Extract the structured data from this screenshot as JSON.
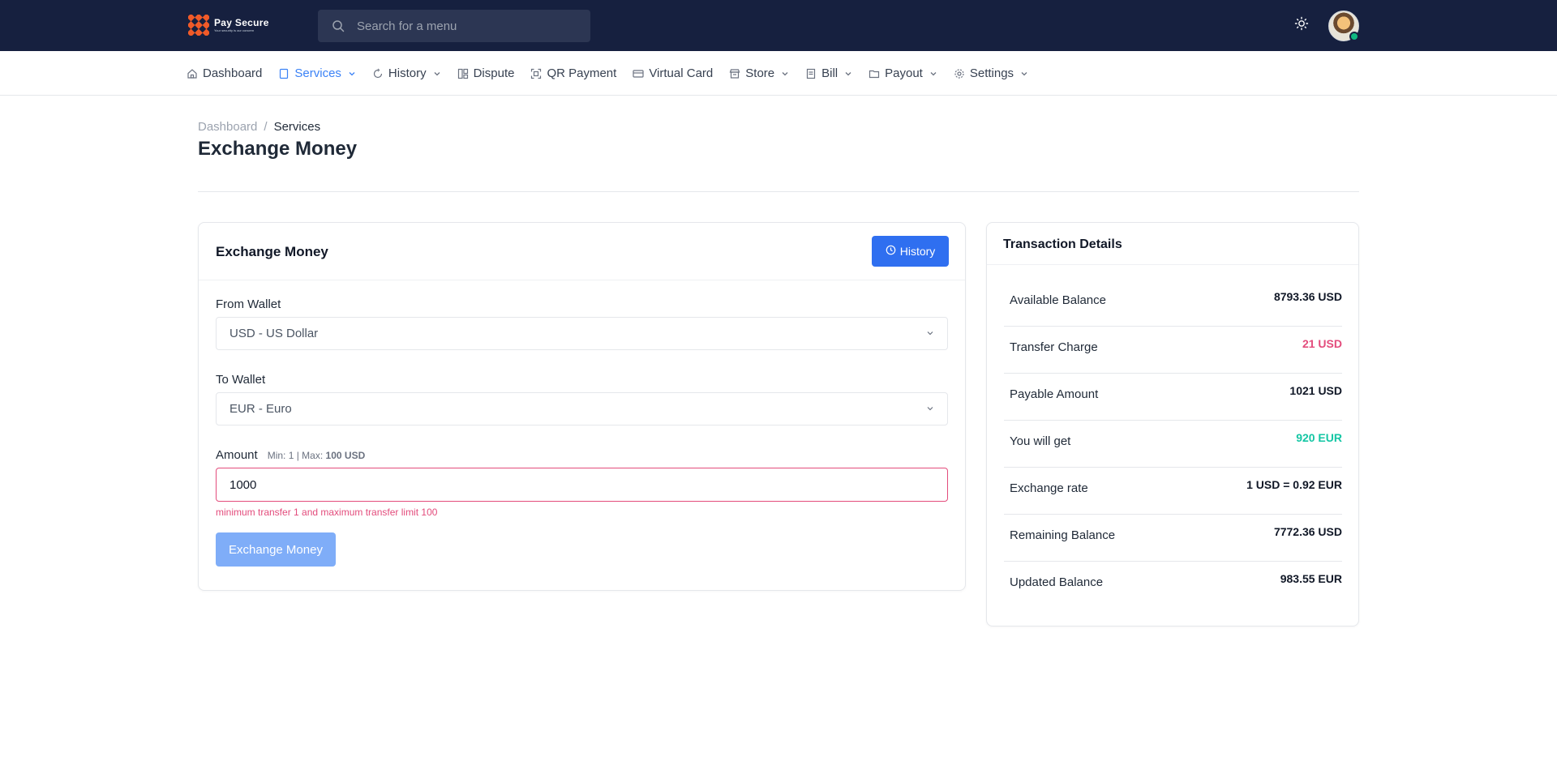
{
  "brand": {
    "name": "Pay Secure",
    "tagline": "Your security is our concern"
  },
  "search": {
    "placeholder": "Search for a menu"
  },
  "icons": {
    "theme": "sun-icon",
    "search": "search-icon"
  },
  "colors": {
    "topbar": "#16203f",
    "primary": "#2f6ff0",
    "error": "#e34c7c",
    "success": "#14c6a4"
  },
  "nav": [
    {
      "label": "Dashboard",
      "icon": "home-icon",
      "dropdown": false,
      "active": false
    },
    {
      "label": "Services",
      "icon": "page-icon",
      "dropdown": true,
      "active": true
    },
    {
      "label": "History",
      "icon": "refresh-icon",
      "dropdown": true,
      "active": false
    },
    {
      "label": "Dispute",
      "icon": "layout-icon",
      "dropdown": false,
      "active": false
    },
    {
      "label": "QR Payment",
      "icon": "qr-icon",
      "dropdown": false,
      "active": false
    },
    {
      "label": "Virtual Card",
      "icon": "card-icon",
      "dropdown": false,
      "active": false
    },
    {
      "label": "Store",
      "icon": "store-icon",
      "dropdown": true,
      "active": false
    },
    {
      "label": "Bill",
      "icon": "bill-icon",
      "dropdown": true,
      "active": false
    },
    {
      "label": "Payout",
      "icon": "wallet-icon",
      "dropdown": true,
      "active": false
    },
    {
      "label": "Settings",
      "icon": "gear-icon",
      "dropdown": true,
      "active": false
    }
  ],
  "breadcrumb": {
    "home": "Dashboard",
    "separator": "/",
    "current": "Services"
  },
  "page": {
    "title": "Exchange Money"
  },
  "exchange": {
    "title": "Exchange Money",
    "history_label": "History",
    "from_label": "From Wallet",
    "from_value": "USD - US Dollar",
    "to_label": "To Wallet",
    "to_value": "EUR - Euro",
    "amount_label": "Amount",
    "amount_hint_min": "Min: 1",
    "amount_hint_max_prefix": "| Max:",
    "amount_hint_max": "100 USD",
    "amount_value": "1000",
    "error": "minimum transfer 1 and maximum transfer limit 100",
    "submit_label": "Exchange Money"
  },
  "details": {
    "title": "Transaction Details",
    "rows": [
      {
        "label": "Available Balance",
        "value": "8793.36 USD",
        "tone": "default"
      },
      {
        "label": "Transfer Charge",
        "value": "21 USD",
        "tone": "pink"
      },
      {
        "label": "Payable Amount",
        "value": "1021 USD",
        "tone": "default"
      },
      {
        "label": "You will get",
        "value": "920 EUR",
        "tone": "teal"
      },
      {
        "label": "Exchange rate",
        "value": "1 USD = 0.92 EUR",
        "tone": "default"
      },
      {
        "label": "Remaining Balance",
        "value": "7772.36 USD",
        "tone": "default"
      },
      {
        "label": "Updated Balance",
        "value": "983.55 EUR",
        "tone": "default"
      }
    ]
  }
}
